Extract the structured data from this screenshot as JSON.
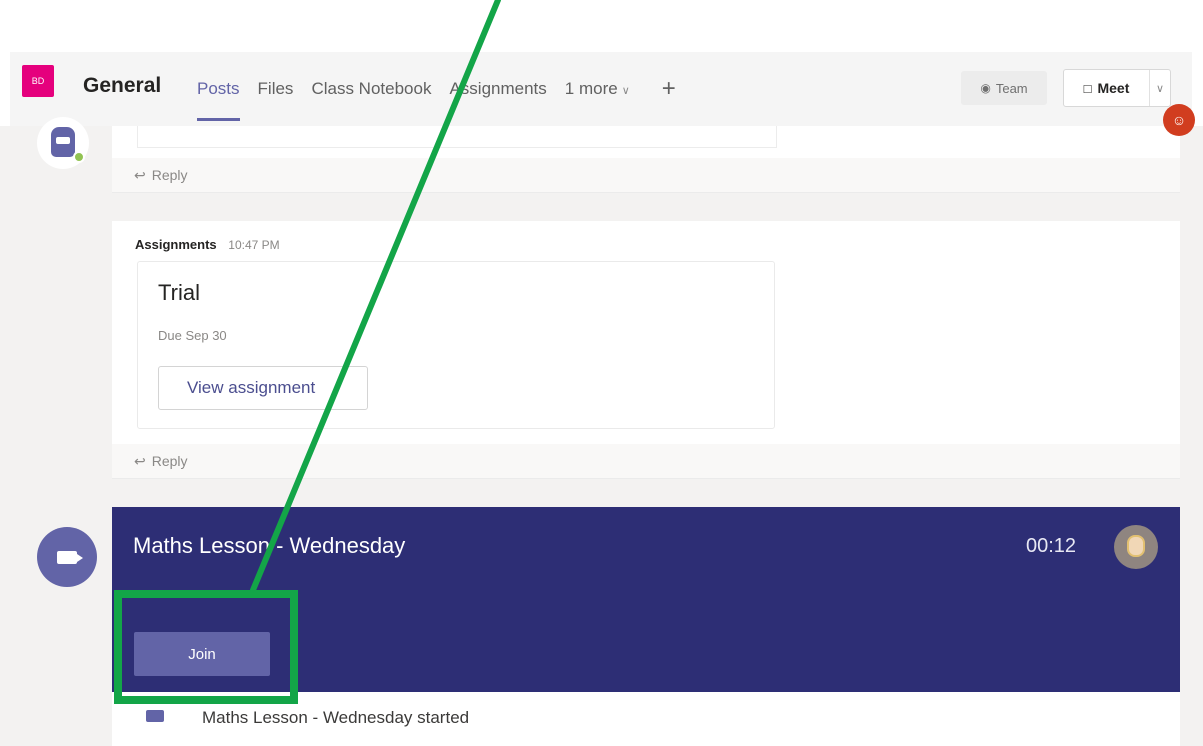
{
  "header": {
    "team_initials": "BD",
    "channel": "General",
    "tabs": [
      {
        "label": "Posts",
        "active": true
      },
      {
        "label": "Files"
      },
      {
        "label": "Class Notebook"
      },
      {
        "label": "Assignments"
      },
      {
        "label": "1 more"
      }
    ],
    "add_tab_icon": "plus-icon",
    "team_button": "Team",
    "meet_button": "Meet"
  },
  "feed": {
    "reply_label": "Reply",
    "assignment_post": {
      "sender": "Assignments",
      "time": "10:47 PM",
      "title": "Trial",
      "due": "Due Sep 30",
      "button": "View assignment"
    },
    "meeting": {
      "title": "Maths Lesson - Wednesday",
      "timer": "00:12",
      "join_button": "Join",
      "started_text": "Maths Lesson - Wednesday started"
    }
  },
  "colors": {
    "accent": "#6264a7",
    "meeting_bg": "#2d2e75",
    "team_avatar": "#e5007d",
    "annotation": "#13a548"
  }
}
